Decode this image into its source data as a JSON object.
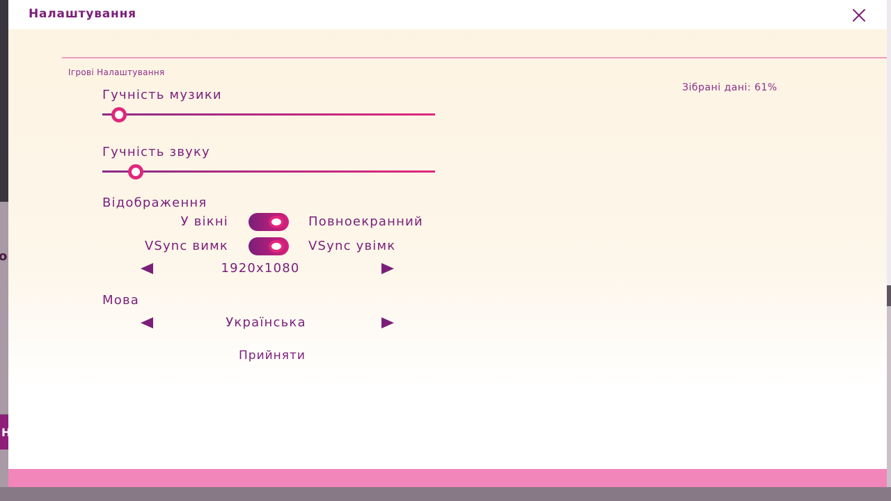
{
  "window": {
    "title": "Налаштування",
    "close_icon": "close-icon"
  },
  "background": {
    "peek_left_letter": "о",
    "peek_left_button_letter": "Н"
  },
  "section": {
    "label": "Ігрові Налаштування"
  },
  "collected_data": {
    "text": "Зібрані дані: 61%"
  },
  "music_volume": {
    "label": "Гучність музики",
    "value": 0.05
  },
  "sound_volume": {
    "label": "Гучність звуку",
    "value": 0.1
  },
  "display": {
    "label": "Відображення",
    "window_mode": {
      "off_label": "У вікні",
      "on_label": "Повноекранний"
    },
    "vsync": {
      "off_label": "VSync вимк",
      "on_label": "VSync увімк"
    },
    "resolution": {
      "value": "1920x1080"
    }
  },
  "language": {
    "label": "Мова",
    "value": "Українська"
  },
  "actions": {
    "accept_label": "Прийняти"
  },
  "colors": {
    "primary": "#7a1f79",
    "accent": "#e0277d",
    "divider": "#ef9cbf",
    "footer": "#f285ba"
  }
}
